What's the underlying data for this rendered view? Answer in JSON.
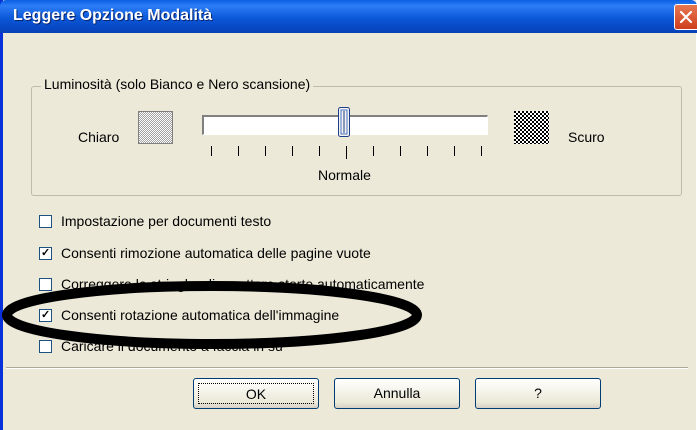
{
  "window": {
    "title": "Leggere Opzione Modalità"
  },
  "brightness_group": {
    "legend": "Luminosità (solo Bianco e Nero scansione)",
    "left_label": "Chiaro",
    "right_label": "Scuro",
    "slider_label": "Normale",
    "slider_value_fraction": 0.5
  },
  "options": [
    {
      "label": "Impostazione  per documenti testo",
      "checked": false
    },
    {
      "label": "Consenti rimozione automatica delle pagine vuote",
      "checked": true
    },
    {
      "label": "Correggere le stringhe di carattere storte automaticamente",
      "checked": false
    },
    {
      "label": "Consenti rotazione automatica dell'immagine",
      "checked": true
    },
    {
      "label": "Caricare il documento a faccia in su",
      "checked": false
    }
  ],
  "buttons": {
    "ok": "OK",
    "cancel": "Annulla",
    "help": "?"
  },
  "colors": {
    "titlebar": "#0b58d8",
    "dialog_bg": "#ece9d8",
    "annotation": "#000000"
  },
  "icons": {
    "close": "close-icon",
    "light_swatch": "light-pattern-icon",
    "dark_swatch": "dark-pattern-icon"
  }
}
